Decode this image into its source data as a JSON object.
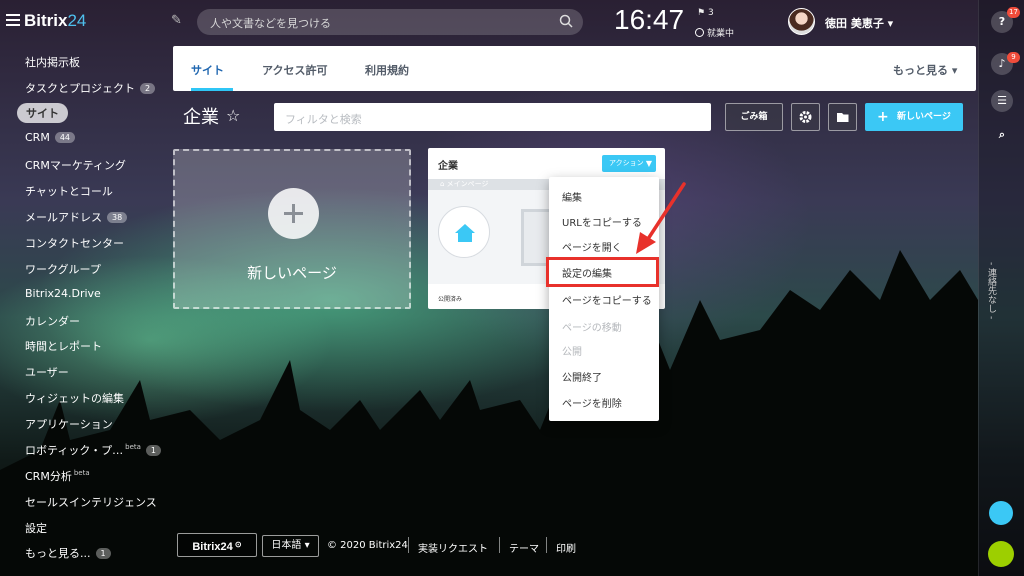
{
  "app": {
    "logo_text": "Bitrix",
    "logo_num": "24",
    "search_placeholder": "人や文書などを見つける",
    "clock": "16:47",
    "flag_count": "3",
    "work_status": "就業中",
    "user_name": "徳田 美恵子"
  },
  "sidebar": {
    "items": [
      {
        "label": "社内掲示板"
      },
      {
        "label": "タスクとプロジェクト",
        "badge": "2"
      },
      {
        "label": "サイト",
        "active": true
      },
      {
        "label": "CRM",
        "badge": "44"
      },
      {
        "label": "CRMマーケティング"
      },
      {
        "label": "チャットとコール"
      },
      {
        "label": "メールアドレス",
        "badge": "38"
      },
      {
        "label": "コンタクトセンター"
      },
      {
        "label": "ワークグループ"
      },
      {
        "label": "Bitrix24.Drive"
      },
      {
        "label": "カレンダー"
      },
      {
        "label": "時間とレポート"
      },
      {
        "label": "ユーザー"
      },
      {
        "label": "ウィジェットの編集"
      },
      {
        "label": "アプリケーション"
      },
      {
        "label": "ロボティック・プ…",
        "beta": "beta",
        "badge": "1"
      },
      {
        "label": "CRM分析",
        "beta": "beta"
      },
      {
        "label": "セールスインテリジェンス"
      },
      {
        "label": "設定"
      },
      {
        "label": "もっと見る...",
        "badge": "1"
      }
    ]
  },
  "rightbar": {
    "help_badge": "17",
    "bell_badge": "9",
    "vertical_text": "- 連絡先なし -"
  },
  "tabs": {
    "items": [
      {
        "label": "サイト"
      },
      {
        "label": "アクセス許可"
      },
      {
        "label": "利用規約"
      }
    ],
    "more": "もっと見る"
  },
  "toolbar": {
    "title": "企業",
    "filter_placeholder": "フィルタと検索",
    "trash_label": "ごみ箱",
    "new_page_label": "新しいページ"
  },
  "new_tile": {
    "label": "新しいページ"
  },
  "site_card": {
    "name": "企業",
    "action_label": "アクション",
    "preview_bar": "メインページ",
    "status": "公開済み"
  },
  "dropdown": {
    "items": [
      {
        "label": "編集",
        "disabled": false
      },
      {
        "label": "URLをコピーする",
        "disabled": false
      },
      {
        "label": "ページを開く",
        "disabled": false
      },
      {
        "label": "設定の編集",
        "disabled": false,
        "highlighted": true
      },
      {
        "label": "ページをコピーする",
        "disabled": false
      },
      {
        "label": "ページの移動",
        "disabled": true
      },
      {
        "label": "公開",
        "disabled": true
      },
      {
        "label": "公開終了",
        "disabled": false
      },
      {
        "label": "ページを削除",
        "disabled": false
      }
    ]
  },
  "footer": {
    "logo": "Bitrix24",
    "language": "日本語",
    "copyright": "© 2020 Bitrix24",
    "request": "実装リクエスト",
    "theme": "テーマ",
    "print": "印刷"
  },
  "colors": {
    "accent": "#3bc8f5",
    "highlight": "#e8312b",
    "tab_active": "#2067b0"
  }
}
